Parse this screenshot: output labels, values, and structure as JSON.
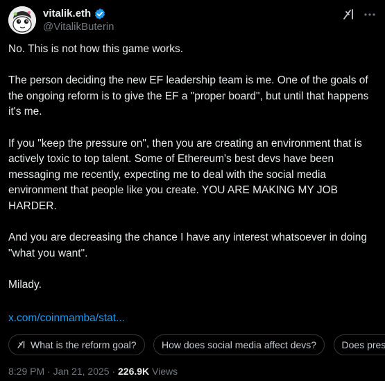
{
  "author": {
    "display_name": "vitalik.eth",
    "handle": "@VitalikButerin",
    "verified": true
  },
  "post": {
    "paragraphs": [
      "No. This is not how this game works.",
      "The person deciding the new EF leadership team is me. One of the goals of the ongoing reform is to give the EF a \"proper board\", but until that happens it's me.",
      "If you \"keep the pressure on\", then you are creating an environment that is actively toxic to top talent. Some of Ethereum's best devs have been messaging me recently, expecting me to deal with the social media environment that people like you create. YOU ARE MAKING MY JOB HARDER.",
      "And you are decreasing the chance I have any interest whatsoever in doing \"what you want\".",
      "Milady."
    ],
    "link_text": "x.com/coinmamba/stat..."
  },
  "grok_chips": [
    "What is the reform goal?",
    "How does social media affect devs?",
    "Does pressure"
  ],
  "meta": {
    "time": "8:29 PM",
    "separator": "·",
    "date": "Jan 21, 2025",
    "views_count": "226.9K",
    "views_label": "Views"
  },
  "icons": {
    "verified": "verified-badge-icon",
    "grok": "grok-icon",
    "more": "more-icon"
  },
  "colors": {
    "background": "#000000",
    "text": "#e7e9ea",
    "secondary": "#71767b",
    "link": "#1d9bf0",
    "verified": "#1d9bf0",
    "chip_border": "#333639"
  }
}
